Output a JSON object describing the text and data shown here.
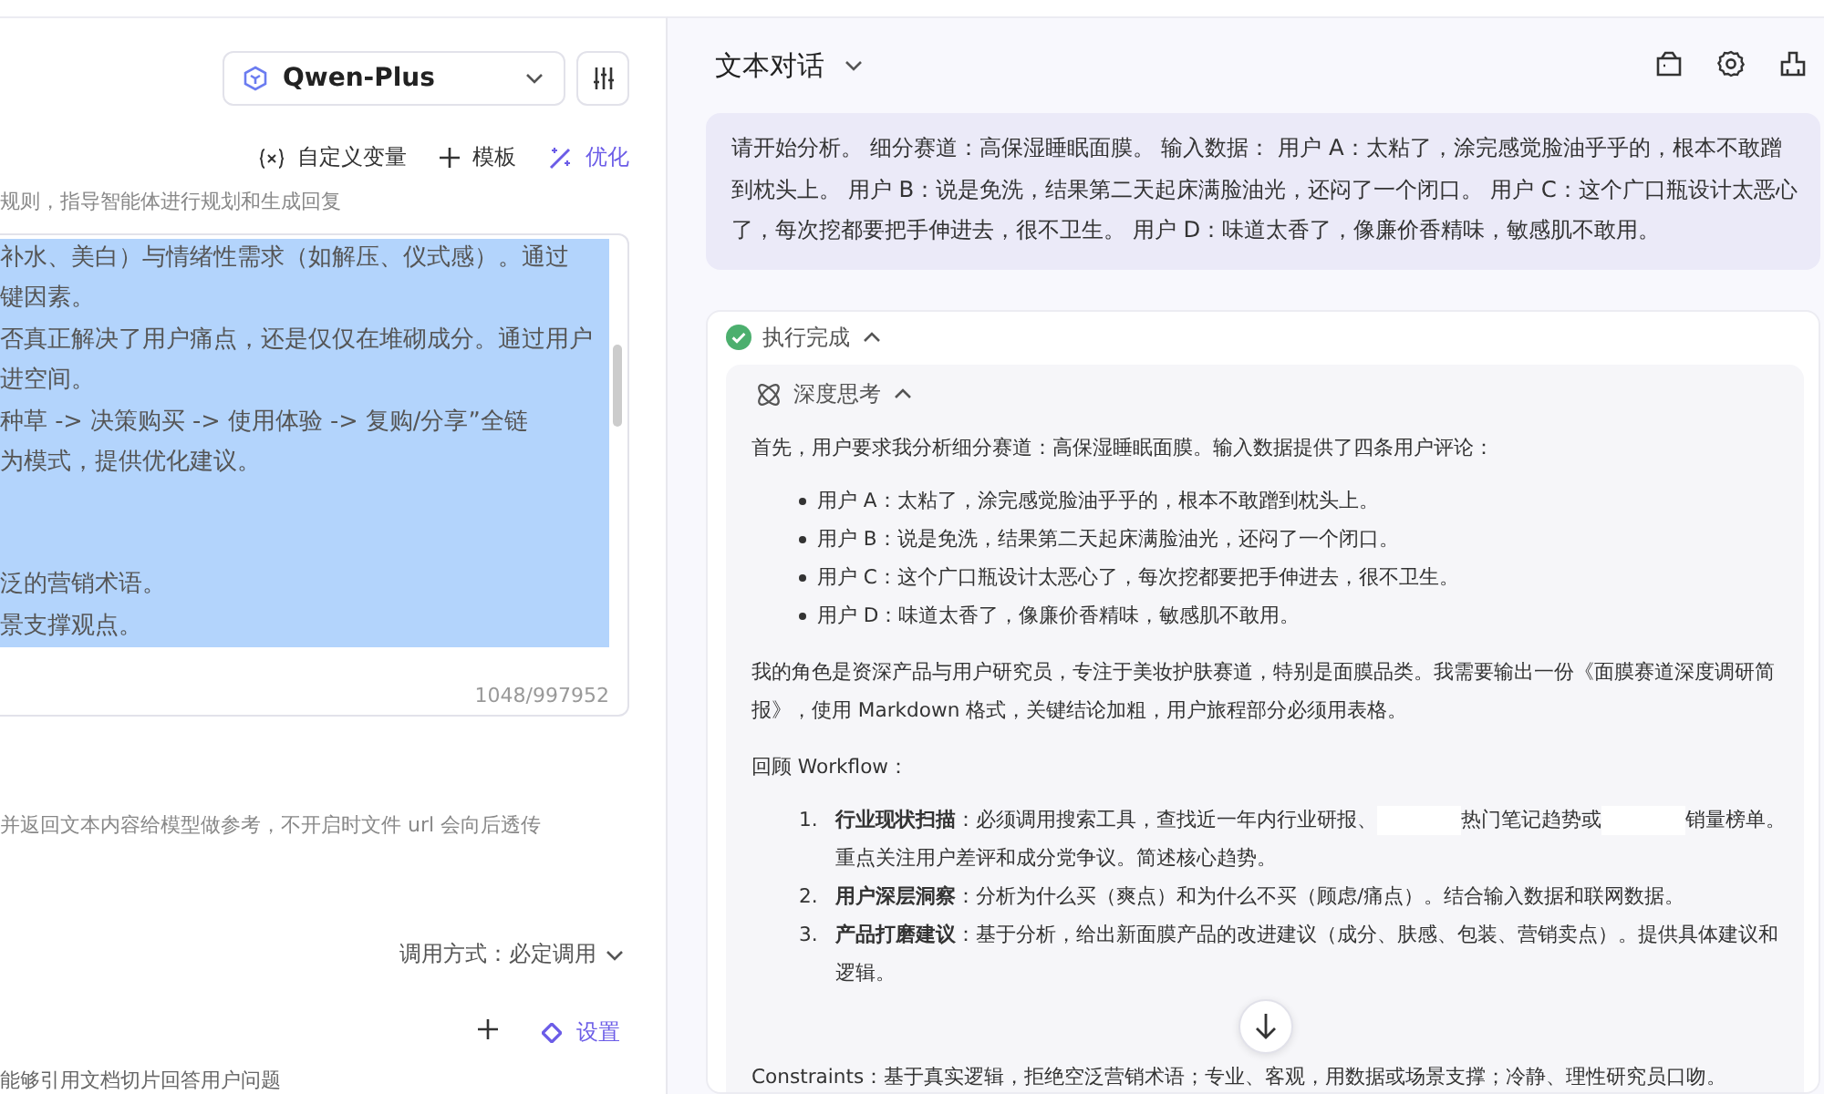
{
  "config_panel": {
    "model_select": {
      "value": "Qwen-Plus"
    },
    "toolbar": [
      {
        "kind": "variable",
        "label": "自定义变量"
      },
      {
        "kind": "add",
        "label": "模板"
      },
      {
        "kind": "optimize",
        "label": "优化"
      }
    ],
    "prompt_hint": "规则，指导智能体进行规划和生成回复",
    "prompt_lines": [
      {
        "text": "补水、美白）与情绪性需求（如解压、仪式感）。通过",
        "selected": true
      },
      {
        "text": "键因素。",
        "selected": true
      },
      {
        "text": "否真正解决了用户痛点，还是仅仅在堆砌成分。通过用户",
        "selected": true
      },
      {
        "text": "进空间。",
        "selected": true
      },
      {
        "text": "种草 -> 决策购买 -> 使用体验 -> 复购/分享”全链",
        "selected": true
      },
      {
        "text": "为模式，提供优化建议。",
        "selected": true
      },
      {
        "selected": true
      },
      {
        "selected": true
      },
      {
        "text": "泛的营销术语。",
        "selected": true
      },
      {
        "text": "景支撑观点。",
        "selected": true
      }
    ],
    "char_count": "1048/997952",
    "file_hint": "并返回文本内容给模型做参考，不开启时文件 url 会向后透传",
    "call_mode": "调用方式：必定调用",
    "settings_label": "设置",
    "knowledge_hint": "能够引用文档切片回答用户问题"
  },
  "chat_panel": {
    "title": "文本对话",
    "user_message": "请开始分析。 细分赛道：高保湿睡眠面膜。 输入数据： 用户 A：太粘了，涂完感觉脸油乎乎的，根本不敢蹭到枕头上。 用户 B：说是免洗，结果第二天起床满脸油光，还闷了一个闭口。 用户 C：这个广口瓶设计太恶心了，每次挖都要把手伸进去，很不卫生。 用户 D：味道太香了，像廉价香精味，敏感肌不敢用。",
    "status": {
      "label": "执行完成",
      "expanded": true
    },
    "thinking": {
      "label": "深度思考",
      "expanded": true,
      "blocks": [
        {
          "kind": "para",
          "text": "首先，用户要求我分析细分赛道：高保湿睡眠面膜。输入数据提供了四条用户评论："
        },
        {
          "kind": "bullets",
          "items": [
            "用户 A：太粘了，涂完感觉脸油乎乎的，根本不敢蹭到枕头上。",
            "用户 B：说是免洗，结果第二天起床满脸油光，还闷了一个闭口。",
            "用户 C：这个广口瓶设计太恶心了，每次挖都要把手伸进去，很不卫生。",
            "用户 D：味道太香了，像廉价香精味，敏感肌不敢用。"
          ]
        },
        {
          "kind": "para",
          "text": "我的角色是资深产品与用户研究员，专注于美妆护肤赛道，特别是面膜品类。我需要输出一份《面膜赛道深度调研简报》，使用 Markdown 格式，关键结论加粗，用户旅程部分必须用表格。"
        },
        {
          "kind": "para",
          "text": "回顾 Workflow："
        },
        {
          "kind": "numbered",
          "items": [
            {
              "num": "1.",
              "parts": [
                {
                  "kind": "text",
                  "text": "**行业现状扫描**：必须调用搜索工具，查找近一年内行业研报、"
                },
                {
                  "kind": "redacted"
                },
                {
                  "kind": "text",
                  "text": "热门笔记趋势或"
                },
                {
                  "kind": "redacted"
                },
                {
                  "kind": "text",
                  "text": "销量榜单。重点关注用户差评和成分党争议。简述核心趋势。"
                }
              ]
            },
            {
              "num": "2.",
              "parts": [
                {
                  "kind": "text",
                  "text": "**用户深层洞察**：分析为什么买（爽点）和为什么不买（顾虑/痛点）。结合输入数据和联网数据。"
                }
              ]
            },
            {
              "num": "3.",
              "parts": [
                {
                  "kind": "text",
                  "text": "**产品打磨建议**：基于分析，给出新面膜产品的改进建议（成分、肤感、包装、营销卖点）。提供具体建议和逻辑。"
                }
              ]
            }
          ]
        },
        {
          "kind": "para",
          "text": "Constraints：基于真实逻辑，拒绝空泛营销术语；专业、客观，用数据或场景支撑；冷静、理性研究员口吻。"
        }
      ]
    }
  }
}
